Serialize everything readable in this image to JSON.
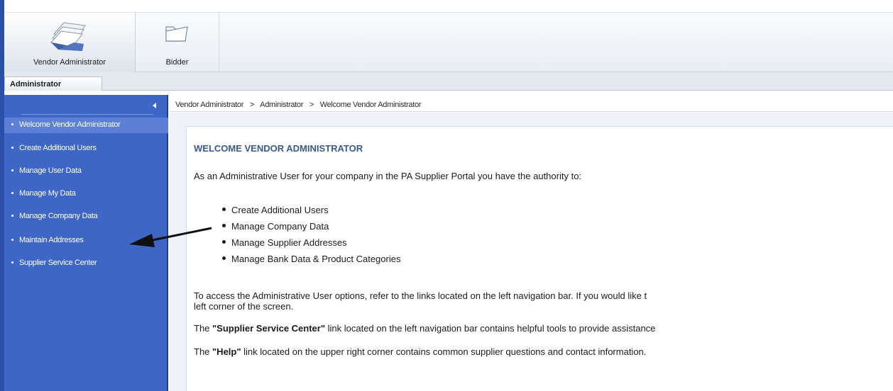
{
  "app_bar": {
    "vendor_admin_label": "Vendor Administrator",
    "bidder_label": "Bidder"
  },
  "subtab": {
    "label": "Administrator"
  },
  "sidebar": {
    "items": [
      {
        "label": "Welcome Vendor Administrator"
      },
      {
        "label": "Create Additional Users"
      },
      {
        "label": "Manage User Data"
      },
      {
        "label": "Manage My Data"
      },
      {
        "label": "Manage Company Data"
      },
      {
        "label": "Maintain Addresses"
      },
      {
        "label": "Supplier Service Center"
      }
    ]
  },
  "breadcrumb": {
    "items": [
      "Vendor Administrator",
      "Administrator",
      "Welcome Vendor Administrator"
    ],
    "separator": ">"
  },
  "content": {
    "title": "WELCOME VENDOR ADMINISTRATOR",
    "intro": "As an Administrative User for your company in the PA Supplier Portal you have the authority to:",
    "bullets": [
      "Create Additional Users",
      "Manage Company Data",
      "Manage Supplier Addresses",
      "Manage Bank Data & Product Categories"
    ],
    "access_line1": "To access the Administrative User options, refer to the links located on the left navigation bar.  If you would like t",
    "access_line2": "left corner of the screen.",
    "ssc_prefix": "The ",
    "ssc_bold": "\"Supplier Service Center\"",
    "ssc_suffix": " link located on the left navigation bar contains helpful tools to provide assistance",
    "help_prefix": "The ",
    "help_bold": "\"Help\"",
    "help_suffix": " link located on the upper right corner contains common supplier questions and contact information."
  },
  "colors": {
    "sidebar": "#3e66c6",
    "sidebar_selected": "#5b80d6",
    "title": "#3b5a88"
  },
  "icons": {
    "vendor_admin": "folders-icon",
    "bidder": "folder-icon",
    "collapse": "triangle-left-icon",
    "annotation": "arrow-icon"
  }
}
